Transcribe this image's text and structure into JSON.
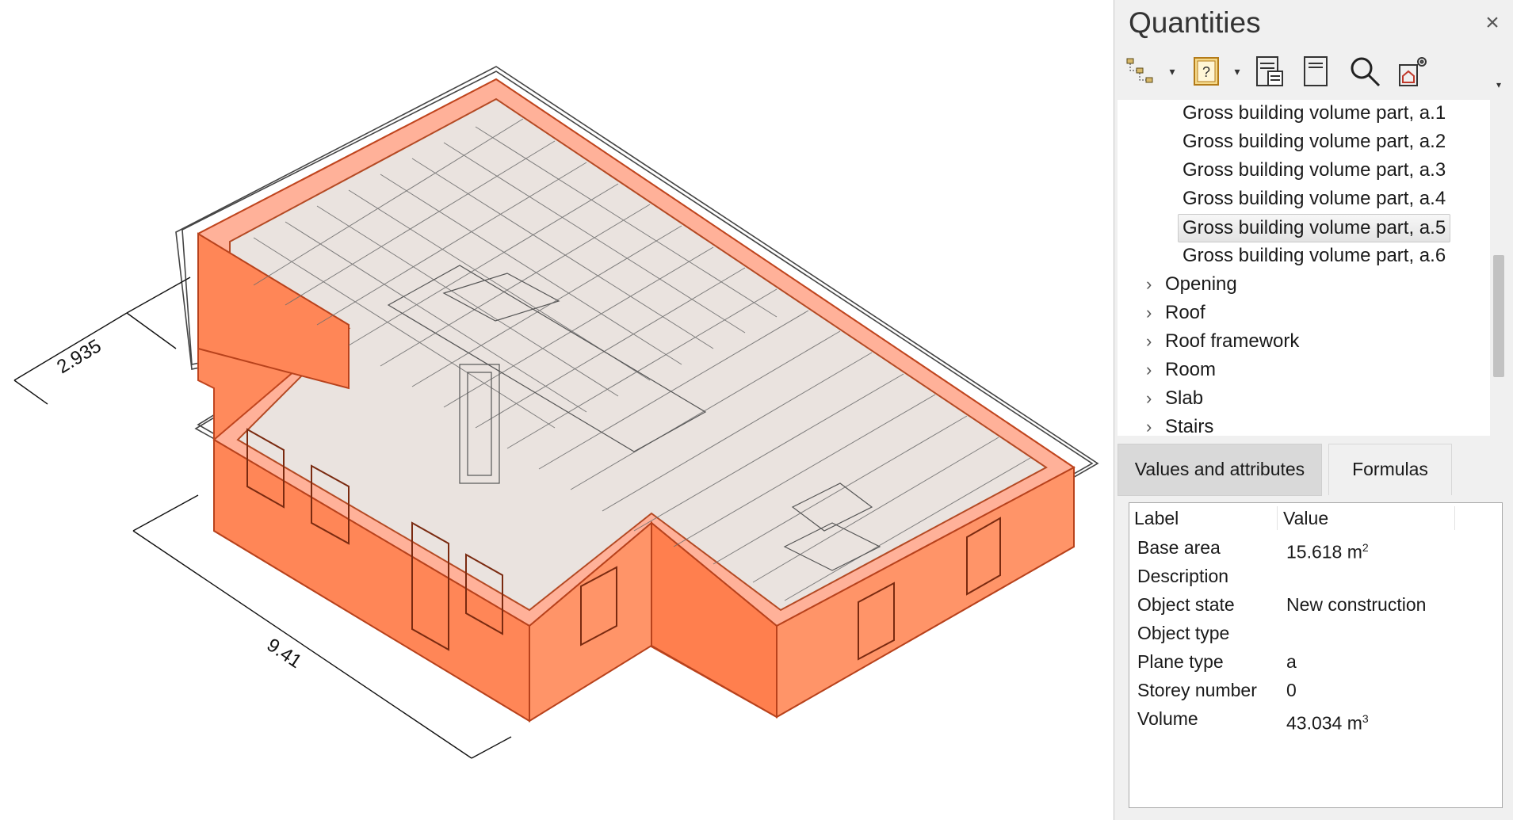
{
  "viewport": {
    "dimensions": {
      "top": "2.935",
      "bottom": "9.41"
    },
    "colors": {
      "highlight_fill": "#ff7b4d",
      "highlight_stroke": "#c0451e",
      "wire": "#555555"
    }
  },
  "panel": {
    "title": "Quantities",
    "close_glyph": "×",
    "toolbar": [
      {
        "name": "tree-structure-icon"
      },
      {
        "name": "help-book-icon"
      },
      {
        "name": "report-list-icon"
      },
      {
        "name": "report-page-icon"
      },
      {
        "name": "search-icon"
      },
      {
        "name": "settings-house-icon"
      }
    ],
    "tree": {
      "items": [
        {
          "label": "Gross building volume part, a.1",
          "type": "leaf"
        },
        {
          "label": "Gross building volume part, a.2",
          "type": "leaf"
        },
        {
          "label": "Gross building volume part, a.3",
          "type": "leaf"
        },
        {
          "label": "Gross building volume part, a.4",
          "type": "leaf"
        },
        {
          "label": "Gross building volume part, a.5",
          "type": "leaf",
          "selected": true
        },
        {
          "label": "Gross building volume part, a.6",
          "type": "leaf"
        },
        {
          "label": "Opening",
          "type": "group"
        },
        {
          "label": "Roof",
          "type": "group"
        },
        {
          "label": "Roof framework",
          "type": "group"
        },
        {
          "label": "Room",
          "type": "group"
        },
        {
          "label": "Slab",
          "type": "group"
        },
        {
          "label": "Stairs",
          "type": "group"
        }
      ]
    },
    "tabs": [
      {
        "label": "Values and attributes",
        "active": true
      },
      {
        "label": "Formulas",
        "active": false
      }
    ],
    "values": {
      "header": {
        "label": "Label",
        "value": "Value"
      },
      "rows": [
        {
          "label": "Base area",
          "value": "15.618 m",
          "sup": "2"
        },
        {
          "label": "Description",
          "value": "",
          "sup": ""
        },
        {
          "label": "Object state",
          "value": "New construction",
          "sup": ""
        },
        {
          "label": "Object type",
          "value": "",
          "sup": ""
        },
        {
          "label": "Plane type",
          "value": "a",
          "sup": ""
        },
        {
          "label": "Storey number",
          "value": "0",
          "sup": ""
        },
        {
          "label": "Volume",
          "value": "43.034 m",
          "sup": "3"
        }
      ]
    }
  }
}
